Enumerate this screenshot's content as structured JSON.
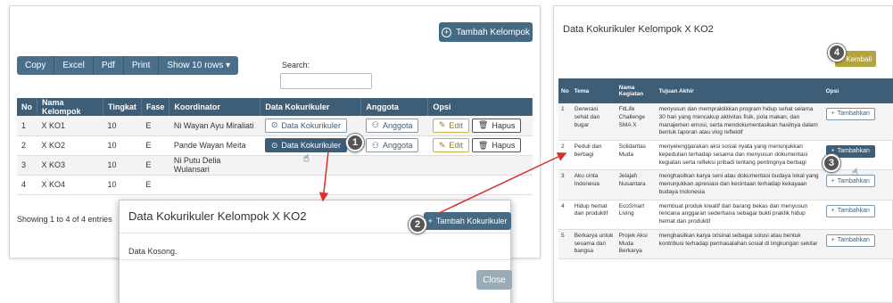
{
  "left": {
    "add_group_label": "Tambah Kelompok",
    "toolbar": [
      "Copy",
      "Excel",
      "Pdf",
      "Print",
      "Show 10 rows ▾"
    ],
    "search_label": "Search:",
    "table": {
      "headers": [
        "No",
        "Nama Kelompok",
        "Tingkat",
        "Fase",
        "Koordinator",
        "Data Kokurikuler",
        "Anggota",
        "Opsi"
      ],
      "rows": [
        {
          "no": "1",
          "nama": "X KO1",
          "tingkat": "10",
          "fase": "E",
          "koordinator": "Ni Wayan Ayu Miraliati"
        },
        {
          "no": "2",
          "nama": "X KO2",
          "tingkat": "10",
          "fase": "E",
          "koordinator": "Pande Wayan Meita"
        },
        {
          "no": "3",
          "nama": "X KO3",
          "tingkat": "10",
          "fase": "E",
          "koordinator": "Ni Putu Delia Wulansari"
        },
        {
          "no": "4",
          "nama": "X KO4",
          "tingkat": "10",
          "fase": "E",
          "koordinator": ""
        }
      ],
      "data_btn_label": "Data Kokurikuler",
      "anggota_btn_label": "Anggota",
      "edit_label": "Edit",
      "hapus_label": "Hapus"
    },
    "showing": "Showing 1 to 4 of 4 entries"
  },
  "modal": {
    "title": "Data Kokurikuler Kelompok X KO2",
    "add_label": "Tambah Kokurikuler",
    "empty_text": "Data Kosong.",
    "close_label": "Close"
  },
  "right": {
    "title": "Data Kokurikuler Kelompok X KO2",
    "back_label": "Kembali",
    "headers": [
      "No",
      "Tema",
      "Nama Kegiatan",
      "Tujuan Akhir",
      "Opsi"
    ],
    "rows": [
      {
        "no": "1",
        "tema": "Generasi sehat dan bugar",
        "kegiatan": "FitLife Challenge SMA X",
        "tujuan": "menyusun dan mempraktikkan program hidup sehat selama 30 hari yang mencakup aktivitas fisik, pola makan, dan manajemen emosi, serta mendokumentasikan hasilnya dalam bentuk laporan atau vlog reflektif"
      },
      {
        "no": "2",
        "tema": "Peduli dan berbagi",
        "kegiatan": "Solidaritas Muda",
        "tujuan": "menyelenggarakan aksi sosial nyata yang menunjukkan kepedulian terhadap sesama dan menyusun dokumentasi kegiatan serta refleksi pribadi tentang pentingnya berbagi"
      },
      {
        "no": "3",
        "tema": "Aku cinta Indonesia",
        "kegiatan": "Jelajah Nusantara",
        "tujuan": "menghasilkan karya seni atau dokumentasi budaya lokal yang menunjukkan apresiasi dan kecintaan terhadap kekayaan budaya Indonesia"
      },
      {
        "no": "4",
        "tema": "Hidup hemat dan produktif",
        "kegiatan": "EcoSmart Living",
        "tujuan": "membuat produk kreatif dari barang bekas dan menyusun rencana anggaran sederhana sebagai bukti praktik hidup hemat dan produktif"
      },
      {
        "no": "5",
        "tema": "Berkarya untuk sesama dan bangsa",
        "kegiatan": "Projek Aksi Muda Berkarya",
        "tujuan": "menghasilkan karya orisinal sebagai solusi atau bentuk kontribusi terhadap permasalahan sosial di lingkungan sekitar"
      }
    ],
    "tambah_label": "Tambahkan"
  },
  "badges": [
    "1",
    "2",
    "3",
    "4"
  ],
  "colors": {
    "primary": "#3e5d76",
    "back": "#b3a53c",
    "arrow": "#d9302a"
  }
}
